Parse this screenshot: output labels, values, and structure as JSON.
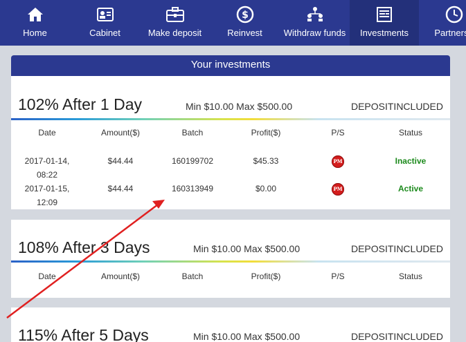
{
  "nav": {
    "items": [
      {
        "label": "Home",
        "icon": "home-icon"
      },
      {
        "label": "Cabinet",
        "icon": "id-card-icon"
      },
      {
        "label": "Make deposit",
        "icon": "briefcase-icon"
      },
      {
        "label": "Reinvest",
        "icon": "dollar-coin-icon"
      },
      {
        "label": "Withdraw funds",
        "icon": "people-network-icon"
      },
      {
        "label": "Investments",
        "icon": "document-icon"
      },
      {
        "label": "Partnersh",
        "icon": "clock-icon"
      }
    ]
  },
  "page": {
    "heading": "Your investments"
  },
  "columns": {
    "date": "Date",
    "amount": "Amount($)",
    "batch": "Batch",
    "profit": "Profit($)",
    "ps": "P/S",
    "status": "Status"
  },
  "plans": [
    {
      "name": "102% After 1 Day",
      "limits": "Min $10.00 Max $500.00",
      "deposit": "DEPOSITINCLUDED",
      "rows": [
        {
          "date_line1": "2017-01-14,",
          "date_line2": "08:22",
          "amount": "$44.44",
          "batch": "160199702",
          "profit": "$45.33",
          "ps": "PM",
          "status": "Inactive"
        },
        {
          "date_line1": "2017-01-15,",
          "date_line2": "12:09",
          "amount": "$44.44",
          "batch": "160313949",
          "profit": "$0.00",
          "ps": "PM",
          "status": "Active"
        }
      ]
    },
    {
      "name": "108% After 3 Days",
      "limits": "Min $10.00 Max $500.00",
      "deposit": "DEPOSITINCLUDED",
      "rows": []
    },
    {
      "name": "115% After 5 Days",
      "limits": "Min $10.00 Max $500.00",
      "deposit": "DEPOSITINCLUDED",
      "rows": []
    }
  ],
  "colors": {
    "nav": "#2b3990",
    "active_status": "#1c8a1c",
    "pm_badge": "#d41d1d",
    "annotation_arrow": "#e02020"
  }
}
